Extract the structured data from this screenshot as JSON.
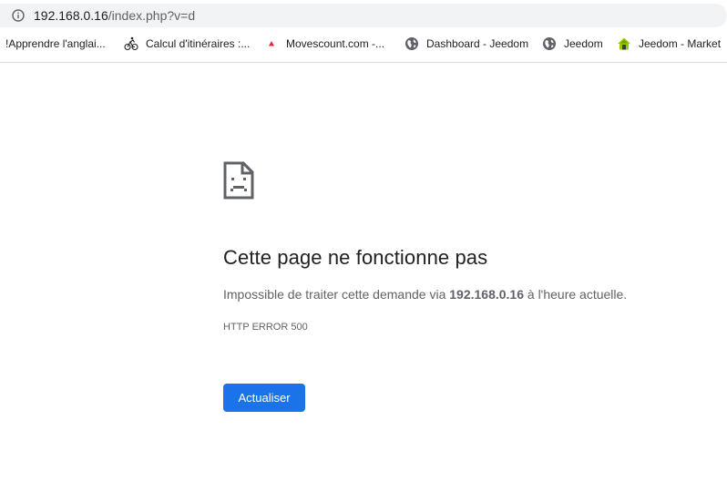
{
  "address_bar": {
    "host": "192.168.0.16",
    "path": "/index.php?v=d"
  },
  "bookmarks": [
    {
      "label": "!Apprendre l'anglai...",
      "icon": "none"
    },
    {
      "label": "Calcul d'itinéraires :...",
      "icon": "bike-icon"
    },
    {
      "label": "Movescount.com -...",
      "icon": "red-triangle-icon"
    },
    {
      "label": "Dashboard - Jeedom",
      "icon": "globe-icon"
    },
    {
      "label": "Jeedom",
      "icon": "globe-icon"
    },
    {
      "label": "Jeedom - Market",
      "icon": "jeedom-house-icon"
    }
  ],
  "error": {
    "icon": "sad-page-icon",
    "title": "Cette page ne fonctionne pas",
    "desc_before": "Impossible de traiter cette demande via ",
    "desc_host": "192.168.0.16",
    "desc_after": " à l'heure actuelle.",
    "code": "HTTP ERROR 500",
    "reload_label": "Actualiser"
  },
  "colors": {
    "accent": "#1a73e8",
    "omnibox_bg": "#f1f3f4",
    "text_primary": "#202124",
    "text_secondary": "#5f6368",
    "bookmark_red": "#e8243a"
  }
}
